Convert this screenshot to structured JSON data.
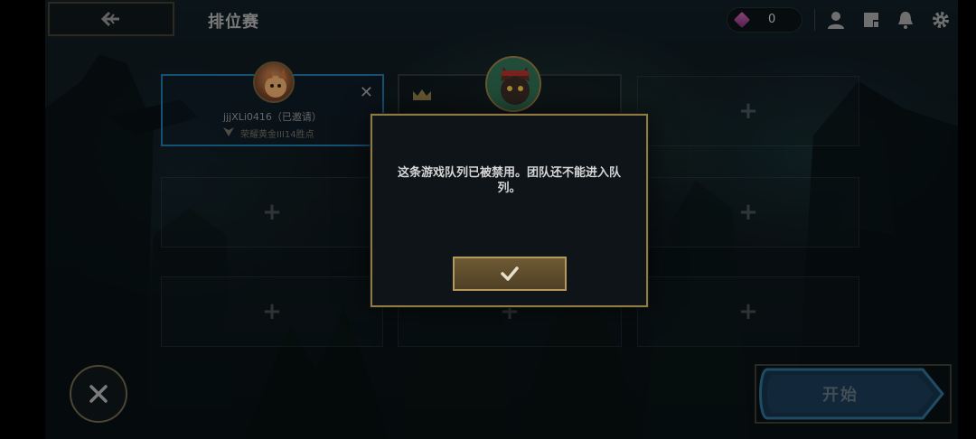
{
  "header": {
    "title": "排位赛",
    "back_icon": "back-arrow-icon",
    "currency": {
      "icon": "gem-icon",
      "value": "0"
    },
    "icons": [
      "profile-icon",
      "store-icon",
      "notification-bell-icon",
      "settings-gear-icon"
    ]
  },
  "party": {
    "invited_player": {
      "name": "jjjXLi0416（已邀请）",
      "rank": "荣耀黄金III14胜点",
      "rank_icon": "rank-emblem-icon",
      "remove_icon": "close-icon"
    },
    "leader": {
      "crown_icon": "crown-icon"
    },
    "empty_slot_symbol": "+"
  },
  "footer": {
    "cancel_icon": "close-icon",
    "start_label": "开始"
  },
  "modal": {
    "message": "这条游戏队列已被禁用。团队还不能进入队列。",
    "confirm_icon": "checkmark-icon"
  },
  "colors": {
    "gold_border": "#8f7a45",
    "button_gold": "#6e5a34",
    "invited_slot_border": "#1f6fa0",
    "start_button": "#2a4a60"
  }
}
